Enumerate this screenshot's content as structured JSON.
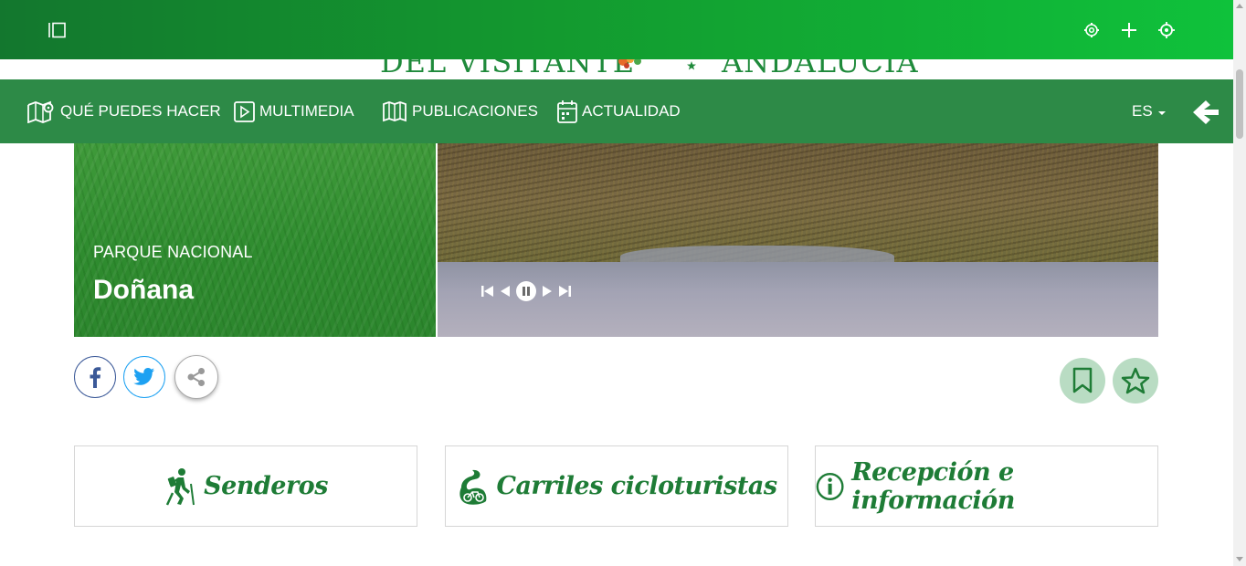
{
  "toolbar": {
    "icons": [
      "sidebar-toggle-icon",
      "settings-icon",
      "plus-icon",
      "crosshair-icon"
    ]
  },
  "logo": {
    "left_text": "DEL VISITANTE",
    "right_text": "ANDALUCÍA"
  },
  "nav": {
    "items": [
      {
        "label": "QUÉ PUEDES HACER",
        "icon": "map-pin-icon"
      },
      {
        "label": "MULTIMEDIA",
        "icon": "play-icon"
      },
      {
        "label": "PUBLICACIONES",
        "icon": "book-icon"
      },
      {
        "label": "ACTUALIDAD",
        "icon": "calendar-icon"
      }
    ],
    "language": "ES"
  },
  "hero": {
    "kicker": "PARQUE NACIONAL",
    "title": "Doñana"
  },
  "cards": [
    {
      "label": "Senderos",
      "icon": "hiker-icon"
    },
    {
      "label": "Carriles cicloturistas",
      "icon": "bicycle-icon"
    },
    {
      "label": "Recepción e información",
      "icon": "info-icon"
    }
  ],
  "colors": {
    "nav_bg": "#2d8a47",
    "brand_green": "#1e7c36",
    "facebook": "#3b5998",
    "twitter": "#1da1f2",
    "action_bg": "#b9dcc3"
  }
}
